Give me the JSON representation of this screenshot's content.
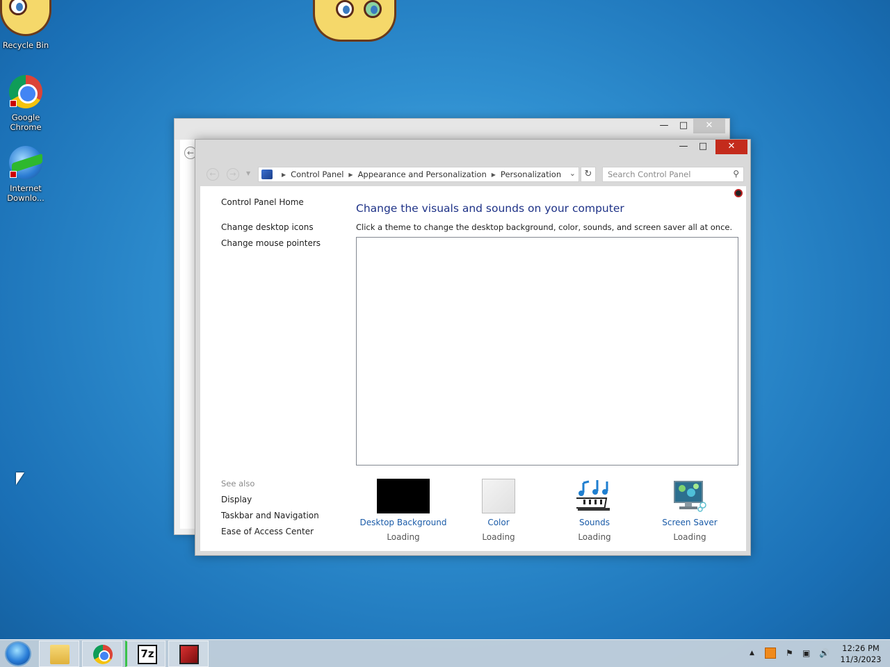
{
  "desktop": {
    "icons": [
      {
        "label": "Recycle Bin",
        "icon": "recycle-bin-icon"
      },
      {
        "label": "Google Chrome",
        "icon": "chrome-icon"
      },
      {
        "label": "Internet Downlo...",
        "icon": "idm-icon"
      }
    ]
  },
  "window": {
    "nav": {
      "back": "←",
      "forward": "→"
    },
    "breadcrumbs": [
      "Control Panel",
      "Appearance and Personalization",
      "Personalization"
    ],
    "search_placeholder": "Search Control Panel",
    "sidebar": {
      "home": "Control Panel Home",
      "links": [
        "Change desktop icons",
        "Change mouse pointers"
      ],
      "see_also_title": "See also",
      "see_also": [
        "Display",
        "Taskbar and Navigation",
        "Ease of Access Center"
      ]
    },
    "heading": "Change the visuals and sounds on your computer",
    "subtext": "Click a theme to change the desktop background, color, sounds, and screen saver all at once.",
    "settings": [
      {
        "label": "Desktop Background",
        "status": "Loading",
        "icon": "desktop-background-thumbnail"
      },
      {
        "label": "Color",
        "status": "Loading",
        "icon": "color-swatch-icon"
      },
      {
        "label": "Sounds",
        "status": "Loading",
        "icon": "sounds-icon"
      },
      {
        "label": "Screen Saver",
        "status": "Loading",
        "icon": "screen-saver-icon"
      }
    ]
  },
  "taskbar": {
    "apps": [
      "file-explorer-icon",
      "chrome-icon",
      "7zip-icon",
      "red-app-icon"
    ],
    "sevenzip_text": "7z",
    "clock": {
      "time": "12:26 PM",
      "date": "11/3/2023"
    }
  },
  "colors": {
    "desktop_bg": "#2f8fd0",
    "link_blue": "#1a5ba8",
    "heading_blue": "#1e3287",
    "close_red": "#c42b1c"
  }
}
